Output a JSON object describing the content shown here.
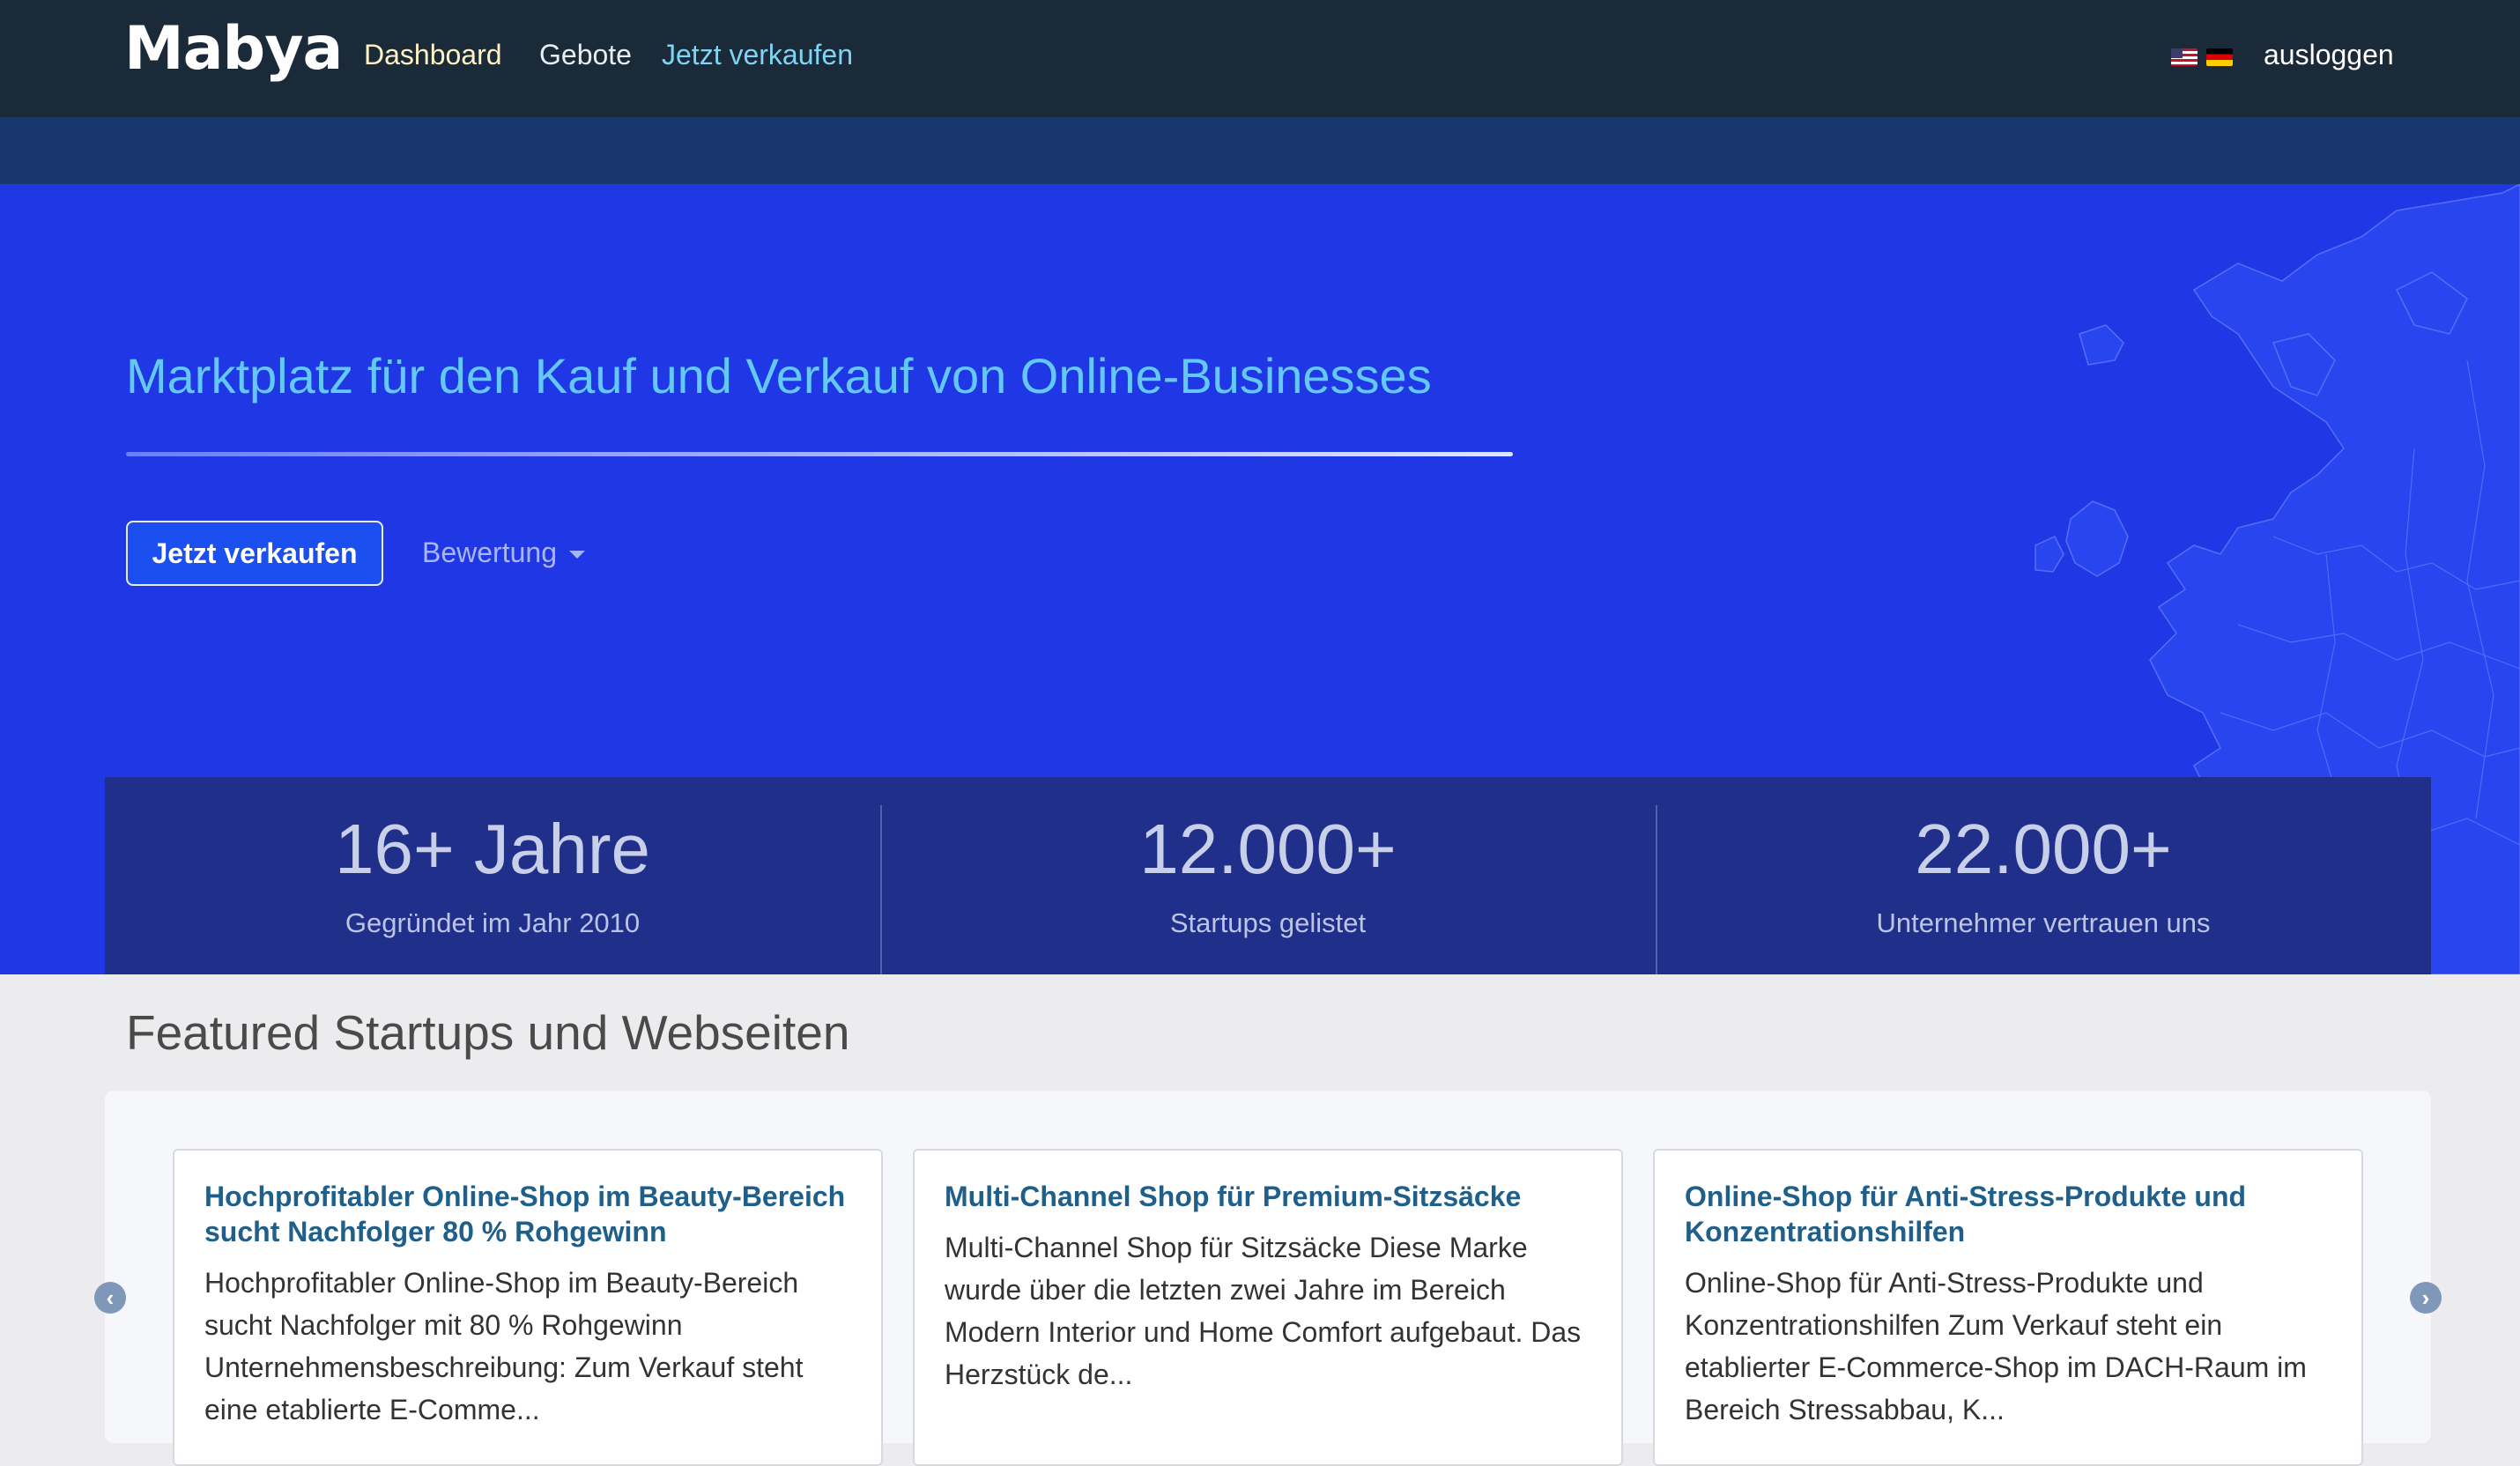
{
  "navbar": {
    "brand": "Mabya",
    "links": {
      "dashboard": "Dashboard",
      "bids": "Gebote",
      "sell": "Jetzt verkaufen"
    },
    "flags": [
      "us-flag-icon",
      "de-flag-icon"
    ],
    "logout": "ausloggen"
  },
  "hero": {
    "title": "Marktplatz für den Kauf und Verkauf von Online-Businesses",
    "sell_button": "Jetzt verkaufen",
    "rating_dropdown": "Bewertung"
  },
  "stats": [
    {
      "value": "16+ Jahre",
      "label": "Gegründet im Jahr 2010"
    },
    {
      "value": "12.000+",
      "label": "Startups gelistet"
    },
    {
      "value": "22.000+",
      "label": "Unternehmer vertrauen uns"
    }
  ],
  "featured": {
    "title": "Featured Startups und Webseiten",
    "cards": [
      {
        "title": "Hochprofitabler Online-Shop im Beauty-Bereich sucht Nachfolger 80 % Rohgewinn",
        "text": "Hochprofitabler Online-Shop im Beauty-Bereich sucht Nachfolger mit 80 % Rohgewinn Unternehmensbeschreibung: Zum Verkauf steht eine etablierte E-Comme..."
      },
      {
        "title": "Multi-Channel Shop für Premium-Sitzsäcke",
        "text": "Multi-Channel Shop für Sitzsäcke Diese Marke wurde über die letzten zwei Jahre im Bereich Modern Interior und Home Comfort aufgebaut. Das Herzstück de..."
      },
      {
        "title": "Online-Shop für Anti-Stress-Produkte und Konzentrationshilfen",
        "text": "Online-Shop für Anti-Stress-Produkte und Konzentrationshilfen Zum Verkauf steht ein etablierter E-Commerce-Shop im DACH-Raum im Bereich Stressabbau, K..."
      }
    ],
    "prev_icon": "chevron-left-icon",
    "next_icon": "chevron-right-icon"
  },
  "colors": {
    "navbar_bg": "#1b2a38",
    "hero_bg": "#2037e6",
    "hero_title": "#63c9f4",
    "stats_bg": "#1f2f8a",
    "card_title": "#1f5f89"
  }
}
